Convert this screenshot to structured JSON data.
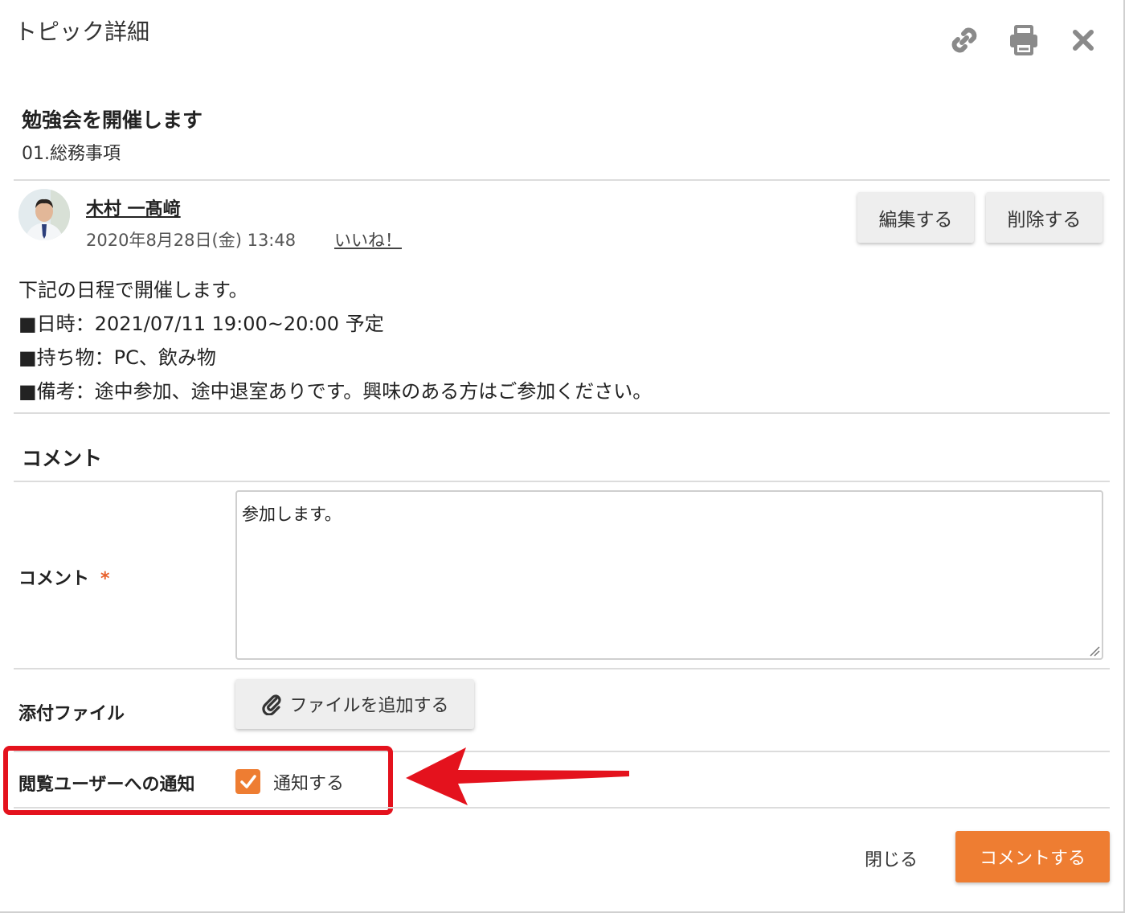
{
  "dialog": {
    "title": "トピック詳細"
  },
  "header_icons": [
    "link-icon",
    "print-icon",
    "close-icon"
  ],
  "topic": {
    "title": "勉強会を開催します",
    "category": "01.総務事項"
  },
  "post": {
    "author": "木村 一髙﨑",
    "date": "2020年8月28日(金) 13:48",
    "like_label": "いいね！",
    "edit_label": "編集する",
    "delete_label": "削除する",
    "body": [
      "下記の日程で開催します。",
      "■日時：2021/07/11 19:00~20:00 予定",
      "■持ち物：PC、飲み物",
      "■備考：途中参加、途中退室ありです。興味のある方はご参加ください。"
    ]
  },
  "comment_section": {
    "title": "コメント",
    "comment_label": "コメント",
    "required_mark": "*",
    "comment_value": "参加します。",
    "attachment_label": "添付ファイル",
    "add_file_label": "ファイルを追加する",
    "notify_label": "閲覧ユーザーへの通知",
    "notify_checkbox_label": "通知する",
    "notify_checked": true
  },
  "footer": {
    "close_label": "閉じる",
    "submit_label": "コメントする"
  },
  "colors": {
    "accent": "#ee7d32",
    "annotation": "#e4121d",
    "divider": "#dcdcdc",
    "button_bg": "#eeeeee"
  }
}
